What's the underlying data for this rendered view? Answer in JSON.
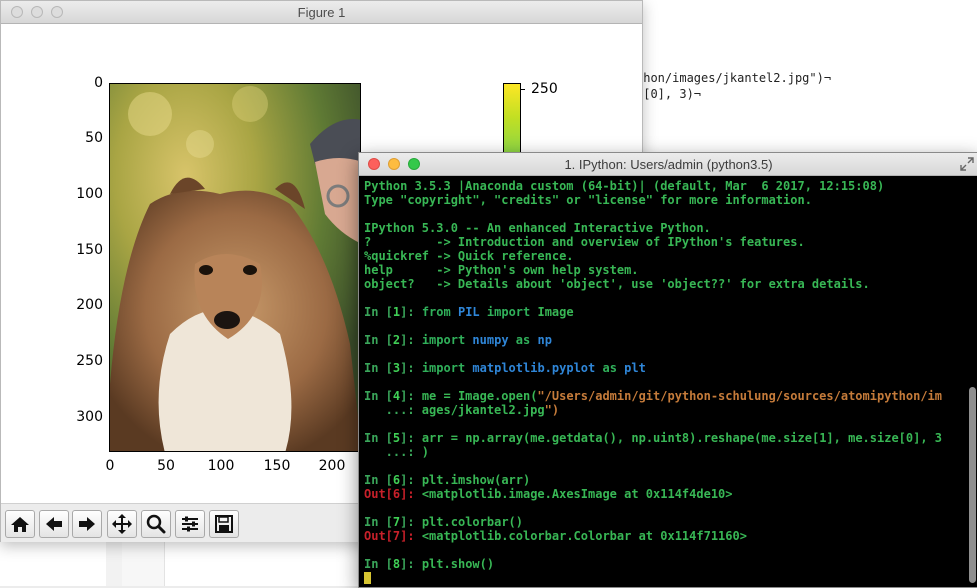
{
  "editor": {
    "line1": "thon/images/jkantel2.jpg\")¬",
    "line2": "e[0], 3)¬"
  },
  "figure": {
    "window_title": "Figure 1",
    "y_ticks": [
      "0",
      "50",
      "100",
      "150",
      "200",
      "250",
      "300"
    ],
    "x_ticks": [
      "0",
      "50",
      "100",
      "150",
      "200"
    ],
    "colorbar_tick": "250",
    "toolbar": {
      "home": "home-icon",
      "back": "arrow-left-icon",
      "forward": "arrow-right-icon",
      "pan": "move-icon",
      "zoom": "magnifier-icon",
      "configure": "sliders-icon",
      "save": "floppy-icon"
    }
  },
  "terminal": {
    "window_title": "1. IPython: Users/admin (python3.5)",
    "banner": [
      "Python 3.5.3 |Anaconda custom (64-bit)| (default, Mar  6 2017, 12:15:08)",
      "Type \"copyright\", \"credits\" or \"license\" for more information.",
      "",
      "IPython 5.3.0 -- An enhanced Interactive Python.",
      "?         -> Introduction and overview of IPython's features.",
      "%quickref -> Quick reference.",
      "help      -> Python's own help system.",
      "object?   -> Details about 'object', use 'object??' for extra details."
    ],
    "cells": [
      {
        "n": "1",
        "code": "from PIL import Image"
      },
      {
        "n": "2",
        "code": "import numpy as np"
      },
      {
        "n": "3",
        "code": "import matplotlib.pyplot as plt"
      },
      {
        "n": "4",
        "code": "me = Image.open(\"/Users/admin/git/python-schulung/sources/atomipython/im",
        "cont": "ages/jkantel2.jpg\")"
      },
      {
        "n": "5",
        "code": "arr = np.array(me.getdata(), np.uint8).reshape(me.size[1], me.size[0], 3",
        "cont": ")"
      },
      {
        "n": "6",
        "code": "plt.imshow(arr)",
        "out": "<matplotlib.image.AxesImage at 0x114f4de10>"
      },
      {
        "n": "7",
        "code": "plt.colorbar()",
        "out": "<matplotlib.colorbar.Colorbar at 0x114f71160>"
      },
      {
        "n": "8",
        "code": "plt.show()"
      }
    ],
    "colors": {
      "text": "#38b755",
      "out_label": "#c8202a",
      "module": "#2f86d8",
      "string": "#c57b3a",
      "cursor": "#d7c532"
    }
  }
}
